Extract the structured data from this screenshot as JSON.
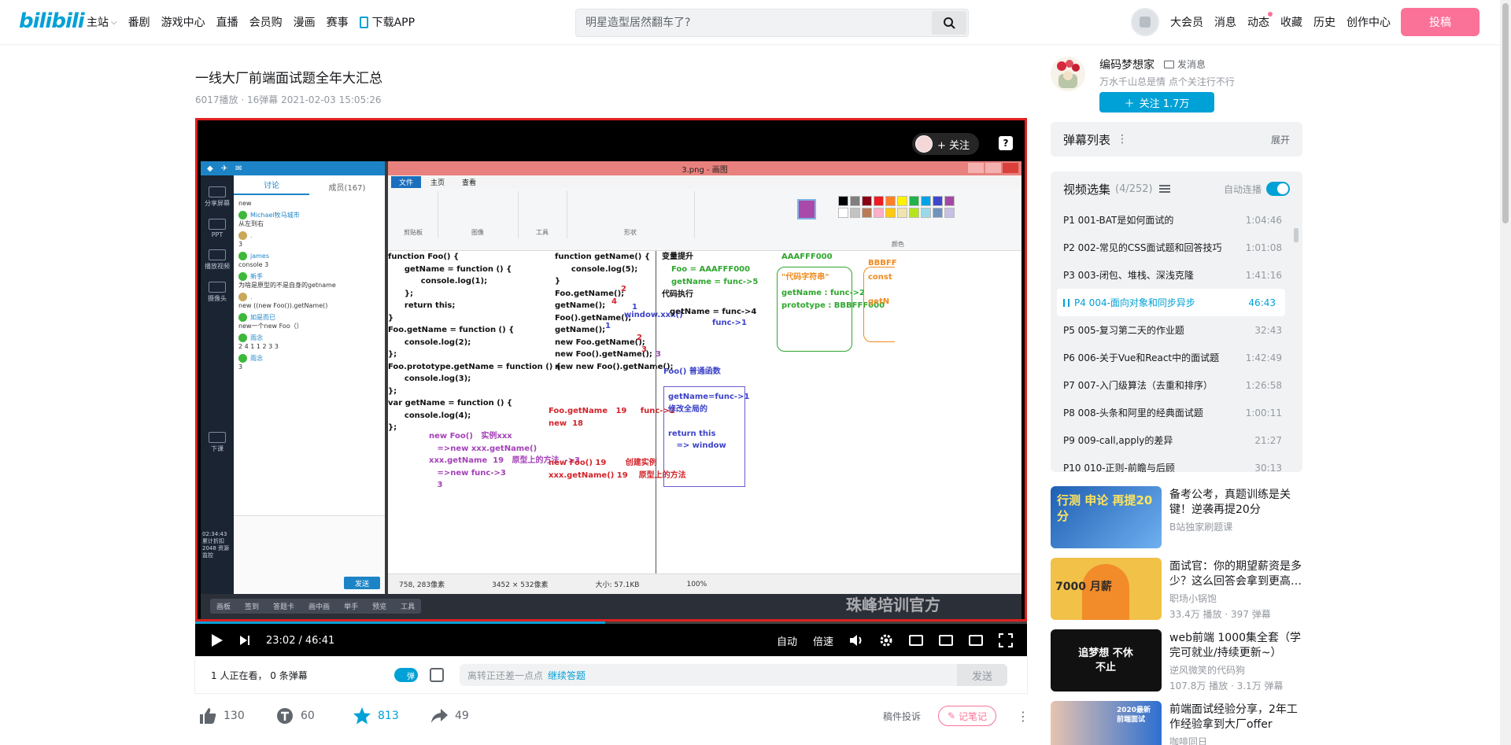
{
  "nav": {
    "logo": "bilibili",
    "items": [
      {
        "label": "主站",
        "has_chevron": true
      },
      {
        "label": "番剧"
      },
      {
        "label": "游戏中心"
      },
      {
        "label": "直播"
      },
      {
        "label": "会员购"
      },
      {
        "label": "漫画"
      },
      {
        "label": "赛事"
      }
    ],
    "download_app": "下载APP",
    "search_placeholder": "明星造型居然翻车了?",
    "right": [
      "大会员",
      "消息",
      "动态",
      "收藏",
      "历史",
      "创作中心"
    ],
    "upload": "投稿"
  },
  "video": {
    "title": "一线大厂前端面试题全年大汇总",
    "meta": "6017播放 · 16弹幕   2021-02-03 15:05:26"
  },
  "player": {
    "follow": "+ 关注",
    "help": "?",
    "current_time": "23:02",
    "separator": "/",
    "duration": "46:41",
    "progress": 0.493,
    "quality": "自动",
    "speed": "倍速",
    "screen": {
      "chat_tabs": [
        "讨论",
        "成员(167)"
      ],
      "side_labels": [
        "分享屏幕",
        "PPT",
        "播放视频",
        "摄像头",
        "下课"
      ],
      "messages": [
        {
          "text": "new"
        },
        {
          "name": "Michael牧马城市",
          "text": "从左到右"
        },
        {
          "name": ".",
          "text": "3"
        },
        {
          "name": "james",
          "text": "console 3"
        },
        {
          "name": "新手",
          "text": "为啥是原型的不是自身的getname"
        },
        {
          "name": ".",
          "text": "new ((new Foo()).getName()"
        },
        {
          "name": "如是而已",
          "text": "new一个new Foo（）"
        },
        {
          "name": "雨念",
          "text": "2 4 1 1 2 3 3"
        },
        {
          "name": "雨念",
          "text": "3"
        }
      ],
      "send": "发送",
      "stats": "02:34:43 累计折扣 2048 资源监控",
      "paint_title": "3.png - 画图",
      "paint_tabs": [
        "文件",
        "主页",
        "查看"
      ],
      "ribbon_labels": [
        "剪贴板",
        "图像",
        "工具",
        "形状",
        "颜色"
      ],
      "status": [
        "758, 283像素",
        "3452 × 532像素",
        "大小: 57.1KB",
        "100%"
      ],
      "taskbar": [
        "画板",
        "签到",
        "答题卡",
        "画中画",
        "举手",
        "预览",
        "工具"
      ],
      "code_left": "function Foo() {\n      getName = function () {\n            console.log(1);\n      };\n      return this;\n}\nFoo.getName = function () {\n      console.log(2);\n};\nFoo.prototype.getName = function () {\n      console.log(3);\n};\nvar getName = function () {\n      console.log(4);\n};",
      "code_mid": "function getName() {\n      console.log(5);\n}\nFoo.getName();\ngetName();\nFoo().getName();\ngetName();\nnew Foo.getName();\nnew Foo().getName();\nnew new Foo().getName();",
      "mid_nums": [
        "2",
        "4",
        "1",
        "1",
        "2",
        "3",
        "3"
      ],
      "window_note": "window.xxx()",
      "anno_left": "new Foo()   实例xxx\n   =>new xxx.getName()\nxxx.getName  19   原型上的方法  ->3\n   =>new func->3\n   3",
      "anno_mid": "Foo.getName   19     func->2\nnew  18",
      "anno_mid2": "new Foo() 19       创建实例\nxxx.getName() 19    原型上的方法",
      "hoist_title": "变量提升",
      "hoist_lines": "Foo = AAAFFF000\ngetName = func->5",
      "exec_title": "代码执行",
      "exec_line": "getName = func->4",
      "exec_line2": "func->1",
      "normal_fn": "Foo() 普通函数",
      "box_text": "getName=func->1\n修改全局的\n\nreturn this\n   => window",
      "heap_addr": "AAAFFF000",
      "heap_title": "\"代码字符串\"",
      "heap_lines": "getName : func->2\nprototype : BBBFFF000",
      "heap2_addr": "BBBFF",
      "heap2_lines": "const\n\ngetN",
      "watermark": "珠峰培训官方"
    }
  },
  "danmaku": {
    "watching": "1 人正在看， 0 条弹幕",
    "toggle": "弹",
    "placeholder": "离转正还差一点点",
    "link": "继续答题",
    "send": "发送"
  },
  "toolbar": {
    "like": "130",
    "coin": "60",
    "favorite": "813",
    "share": "49",
    "report": "稿件投诉",
    "note": "记笔记"
  },
  "uploader": {
    "name": "编码梦想家",
    "message": "发消息",
    "desc": "万水千山总是情 点个关注行不行",
    "follow": "关注 1.7万"
  },
  "danmaku_list": {
    "title": "弹幕列表",
    "expand": "展开"
  },
  "episodes": {
    "title": "视频选集",
    "count": "(4/252)",
    "autoplay": "自动连播",
    "items": [
      {
        "label": "P1   001-BAT是如何面试的",
        "dur": "1:04:46"
      },
      {
        "label": "P2   002-常见的CSS面试题和回答技巧",
        "dur": "1:01:08"
      },
      {
        "label": "P3   003-闭包、堆栈、深浅克隆",
        "dur": "1:41:16"
      },
      {
        "label": "P4   004-面向对象和同步异步",
        "dur": "46:43",
        "active": true
      },
      {
        "label": "P5   005-复习第二天的作业题",
        "dur": "32:43"
      },
      {
        "label": "P6   006-关于Vue和React中的面试题",
        "dur": "1:42:49"
      },
      {
        "label": "P7   007-入门级算法（去重和排序）",
        "dur": "1:26:58"
      },
      {
        "label": "P8   008-头条和阿里的经典面试题",
        "dur": "1:00:11"
      },
      {
        "label": "P9   009-call,apply的差异",
        "dur": "21:27"
      },
      {
        "label": "P10   010-正则-前瞻与后顾",
        "dur": "30:13"
      }
    ]
  },
  "recommend": [
    {
      "title": "备考公考，真题训练是关键！逆袭再提20分",
      "author": "B站独家刷题课",
      "stats": "",
      "thumb_text": "行测 申论 再提20分",
      "color": "#1f5fb3"
    },
    {
      "title": "面试官：你的期望薪资是多少？这么回答会拿到更高…",
      "author": "职场小锅饱",
      "stats": "33.4万 播放 · 397 弹幕",
      "thumb_text": "7000 月薪",
      "color": "#f1c148"
    },
    {
      "title": "web前端 1000集全套（学完可就业/持续更新~）",
      "author": "逆风微笑的代码狗",
      "stats": "107.8万 播放 · 3.1万 弹幕",
      "thumb_text": "追梦想 不休不止",
      "color": "#111111"
    },
    {
      "title": "前端面试经验分享，2年工作经验拿到大厂offer",
      "author": "咖啡同日",
      "stats": "",
      "thumb_text": "2020最新 前端面试",
      "color": "#2d6fd1"
    }
  ]
}
